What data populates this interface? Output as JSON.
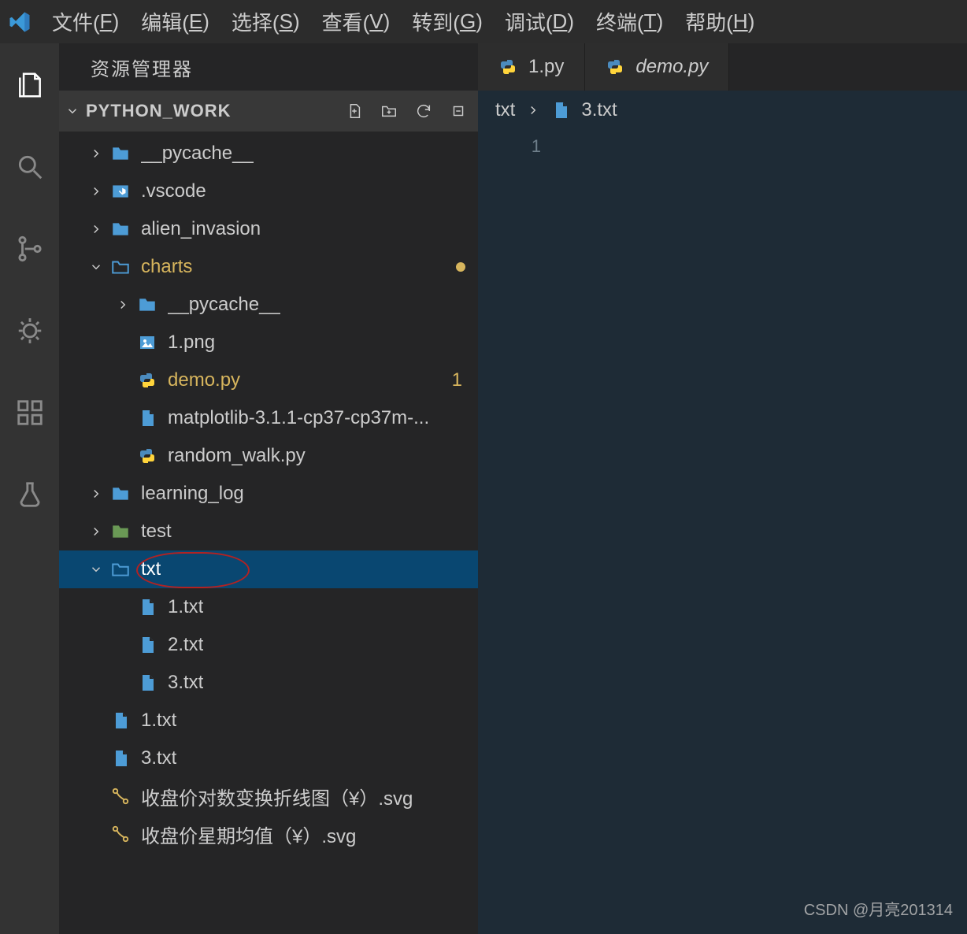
{
  "menu": {
    "file": "文件(",
    "file_k": "F",
    "edit": "编辑(",
    "edit_k": "E",
    "sel": "选择(",
    "sel_k": "S",
    "view": "查看(",
    "view_k": "V",
    "go": "转到(",
    "go_k": "G",
    "debug": "调试(",
    "debug_k": "D",
    "term": "终端(",
    "term_k": "T",
    "help": "帮助(",
    "help_k": "H",
    "cp": ")"
  },
  "sidebar": {
    "title": "资源管理器",
    "section": "PYTHON_WORK",
    "rows": [
      {
        "id": "pycache",
        "label": "__pycache__",
        "chev": "right",
        "icon": "folder",
        "indent": 1
      },
      {
        "id": "vscode",
        "label": ".vscode",
        "chev": "right",
        "icon": "vscode-folder",
        "indent": 1
      },
      {
        "id": "alien",
        "label": "alien_invasion",
        "chev": "right",
        "icon": "folder",
        "indent": 1
      },
      {
        "id": "charts",
        "label": "charts",
        "chev": "down",
        "icon": "folder-open",
        "indent": 1,
        "mod": true,
        "dot": true
      },
      {
        "id": "charts-pyc",
        "label": "__pycache__",
        "chev": "right",
        "icon": "folder",
        "indent": 2
      },
      {
        "id": "png",
        "label": "1.png",
        "icon": "image",
        "indent": 2
      },
      {
        "id": "demo",
        "label": "demo.py",
        "icon": "python",
        "indent": 2,
        "mod": true,
        "mark": "1"
      },
      {
        "id": "matplotlib",
        "label": "matplotlib-3.1.1-cp37-cp37m-...",
        "icon": "file",
        "indent": 2
      },
      {
        "id": "rwalk",
        "label": "random_walk.py",
        "icon": "python",
        "indent": 2
      },
      {
        "id": "llog",
        "label": "learning_log",
        "chev": "right",
        "icon": "folder",
        "indent": 1
      },
      {
        "id": "test",
        "label": "test",
        "chev": "right",
        "icon": "folder-green",
        "indent": 1
      },
      {
        "id": "txt",
        "label": "txt",
        "chev": "down",
        "icon": "folder-open",
        "indent": 1,
        "selected": true,
        "ring": true
      },
      {
        "id": "1txt-in",
        "label": "1.txt",
        "icon": "file",
        "indent": 2
      },
      {
        "id": "2txt-in",
        "label": "2.txt",
        "icon": "file",
        "indent": 2
      },
      {
        "id": "3txt-in",
        "label": "3.txt",
        "icon": "file",
        "indent": 2
      },
      {
        "id": "1txt",
        "label": "1.txt",
        "icon": "file",
        "indent": 1
      },
      {
        "id": "3txt",
        "label": "3.txt",
        "icon": "file",
        "indent": 1
      },
      {
        "id": "svg1",
        "label": "收盘价对数变换折线图（¥）.svg",
        "icon": "svg",
        "indent": 1
      },
      {
        "id": "svg2",
        "label": "收盘价星期均值（¥）.svg",
        "icon": "svg",
        "indent": 1
      }
    ]
  },
  "tabs": [
    {
      "id": "t1",
      "label": "1.py",
      "icon": "python"
    },
    {
      "id": "t2",
      "label": "demo.py",
      "icon": "python",
      "italic": true
    }
  ],
  "breadcrumb": {
    "seg1": "txt",
    "seg2": "3.txt"
  },
  "editor": {
    "line": "1"
  },
  "watermark": "CSDN @月亮201314"
}
